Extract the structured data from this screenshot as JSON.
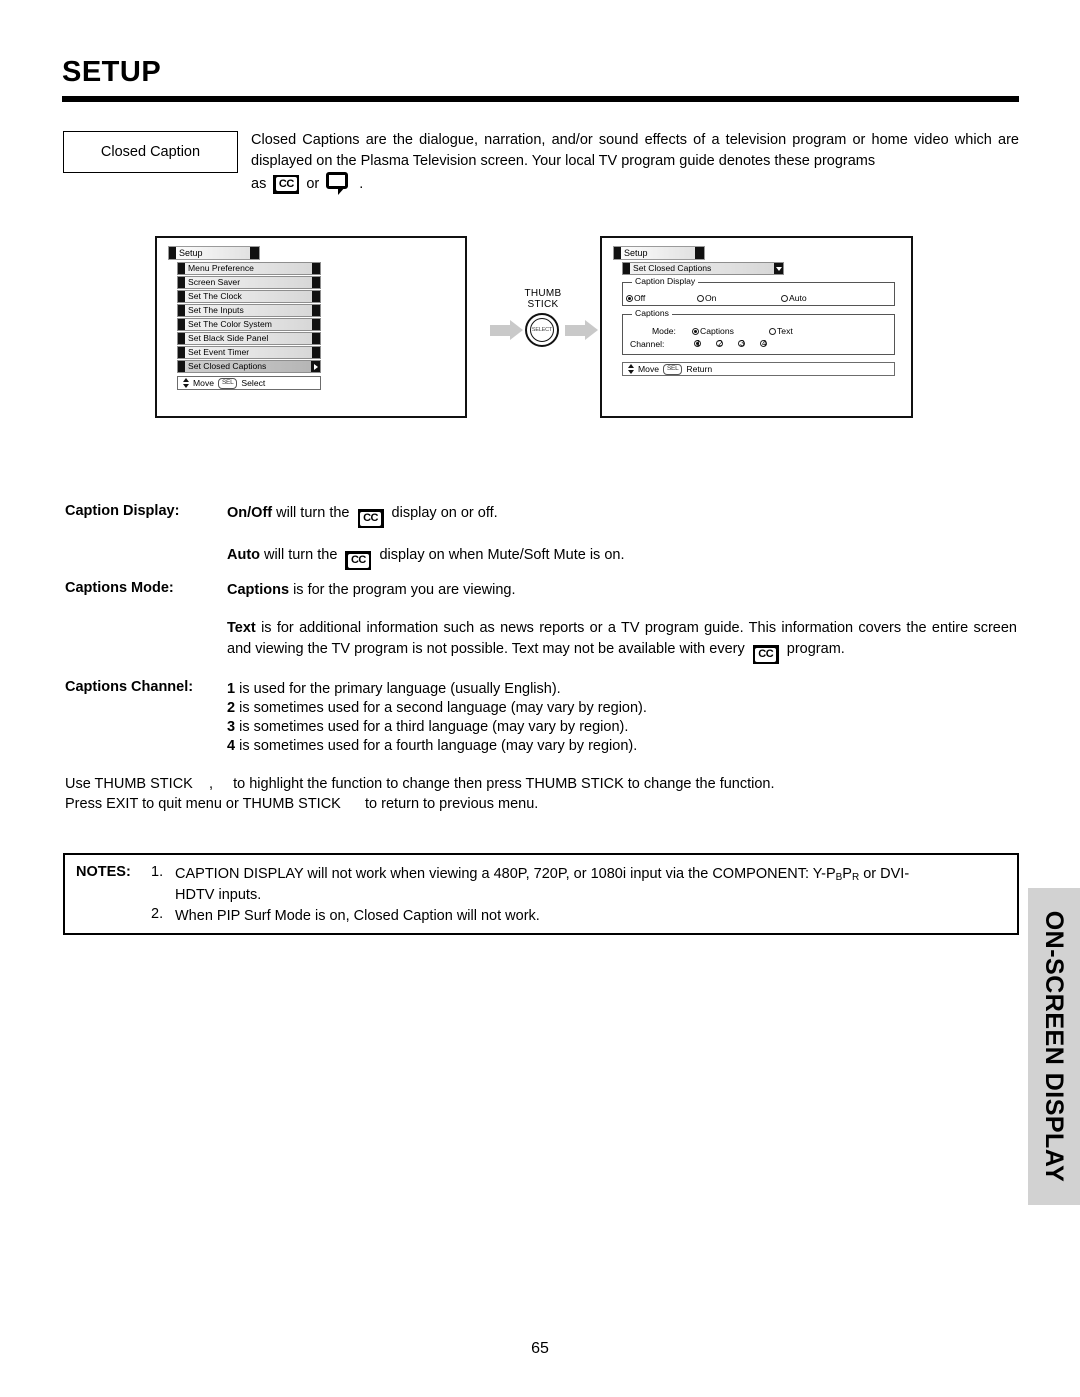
{
  "page": {
    "title": "SETUP",
    "number": "65",
    "side_tab": "ON-SCREEN DISPLAY"
  },
  "intro": {
    "label": "Closed Caption",
    "paragraph": "Closed Captions are the dialogue, narration, and/or sound effects of a television program or home video which are displayed on the Plasma Television screen.  Your local TV program guide denotes these programs",
    "line3_prefix": "as",
    "line3_middle": "or",
    "line3_suffix": ".",
    "cc_icon_label": "CC"
  },
  "diagram": {
    "thumb_stick_label_line1": "THUMB",
    "thumb_stick_label_line2": "STICK",
    "select_knob_label": "SELECT",
    "left_menu": {
      "title": "Setup",
      "items": [
        "Menu Preference",
        "Screen Saver",
        "Set The Clock",
        "Set The Inputs",
        "Set The Color System",
        "Set Black Side Panel",
        "Set Event Timer",
        "Set Closed Captions"
      ],
      "footer_move": "Move",
      "footer_key": "SEL",
      "footer_action": "Select"
    },
    "right_menu": {
      "title": "Setup",
      "subtitle": "Set Closed Captions",
      "caption_display": {
        "group_title": "Caption Display",
        "options": [
          {
            "label": "Off",
            "selected": true
          },
          {
            "label": "On",
            "selected": false
          },
          {
            "label": "Auto",
            "selected": false
          }
        ]
      },
      "captions": {
        "group_title": "Captions",
        "mode_label": "Mode:",
        "mode_options": [
          {
            "label": "Captions",
            "selected": true
          },
          {
            "label": "Text",
            "selected": false
          }
        ],
        "channel_label": "Channel:",
        "channel_options": [
          {
            "label": "1",
            "selected": true
          },
          {
            "label": "2",
            "selected": false
          },
          {
            "label": "3",
            "selected": false
          },
          {
            "label": "4",
            "selected": false
          }
        ]
      },
      "footer_move": "Move",
      "footer_key": "SEL",
      "footer_action": "Return"
    }
  },
  "sections": {
    "caption_display_label": "Caption Display:",
    "caption_display_line1_a": "On/Off",
    "caption_display_line1_b": "will turn the",
    "caption_display_line1_c": "display on or off.",
    "caption_display_line2_a": "Auto",
    "caption_display_line2_b": "will turn the",
    "caption_display_line2_c": "display on when Mute/Soft Mute is on.",
    "captions_mode_label": "Captions Mode:",
    "captions_mode_line1_a": "Captions",
    "captions_mode_line1_b": "is for the program you are viewing.",
    "captions_mode_text_a": "Text",
    "captions_mode_text_b": "is for additional information such as news reports or a TV program guide.  This information covers the entire screen and viewing the TV program is not possible.  Text may not be available with every",
    "captions_mode_text_c": "program.",
    "captions_channel_label": "Captions Channel:",
    "channel_lines": [
      {
        "num": "1",
        "text": "is used for the primary language (usually English)."
      },
      {
        "num": "2",
        "text": "is sometimes used for a second language (may vary by region)."
      },
      {
        "num": "3",
        "text": "is sometimes used for a third language (may vary by region)."
      },
      {
        "num": "4",
        "text": "is sometimes used for a fourth language (may vary by region)."
      }
    ],
    "usage_line1": "Use THUMB STICK    ,     to highlight the function to change then press THUMB STICK to change the function.",
    "usage_line2": "Press EXIT to quit menu or THUMB STICK      to return to previous menu."
  },
  "notes": {
    "label": "NOTES:",
    "items": [
      {
        "num": "1.",
        "text_a": "CAPTION DISPLAY will not work when viewing a 480P, 720P, or 1080i input via the COMPONENT: Y-P",
        "sub_b": "B",
        "text_c": "P",
        "sub_d": "R",
        "text_e": " or DVI-",
        "text_line2": "HDTV inputs."
      },
      {
        "num": "2.",
        "text_a": "When PIP Surf Mode is on, Closed Caption will not work."
      }
    ]
  },
  "colors": {
    "ink": "#000000",
    "side_tab_bg": "#d2d2d2",
    "arrow_gray": "#c9c9c9"
  }
}
